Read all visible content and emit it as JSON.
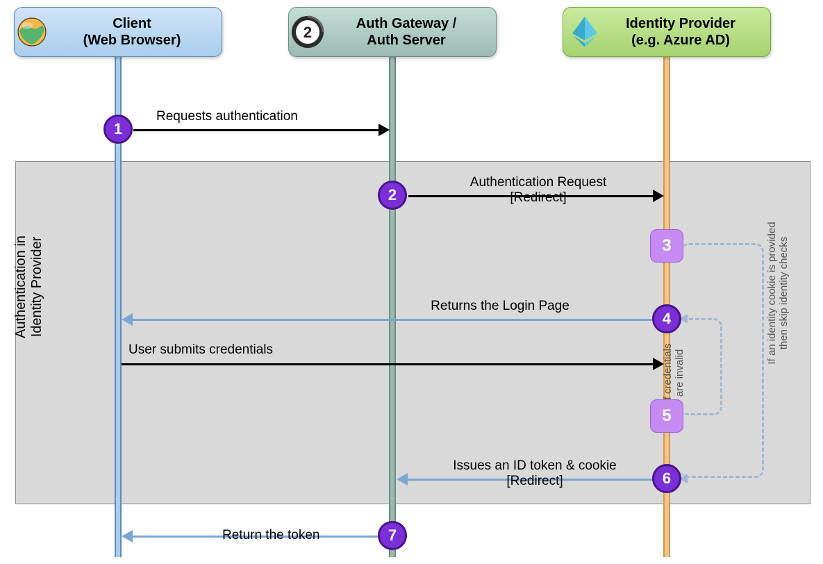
{
  "participants": {
    "client": "Client\n(Web Browser)",
    "auth": "Auth Gateway /\nAuth Server",
    "idp": "Identity Provider\n(e.g. Azure AD)"
  },
  "phase_label": "Authentication in\nIdentity Provider",
  "steps": {
    "s1": "1",
    "s2": "2",
    "s3": "3",
    "s4": "4",
    "s5": "5",
    "s6": "6",
    "s7": "7"
  },
  "messages": {
    "m1": "Requests authentication",
    "m2_line1": "Authentication Request",
    "m2_line2": "[Redirect]",
    "m4": "Returns the Login Page",
    "m4b": "User submits credentials",
    "m6_line1": "Issues an ID token & cookie",
    "m6_line2": "[Redirect]",
    "m7": "Return the token"
  },
  "notes": {
    "skip_identity": "If an identity cookie is provided\nthen skip identity checks",
    "invalid_creds": "If credentials\nare invalid"
  },
  "icons": {
    "client": "globe-icon",
    "auth": "oauth2-badge-icon",
    "idp": "ethereum-diamond-icon"
  }
}
